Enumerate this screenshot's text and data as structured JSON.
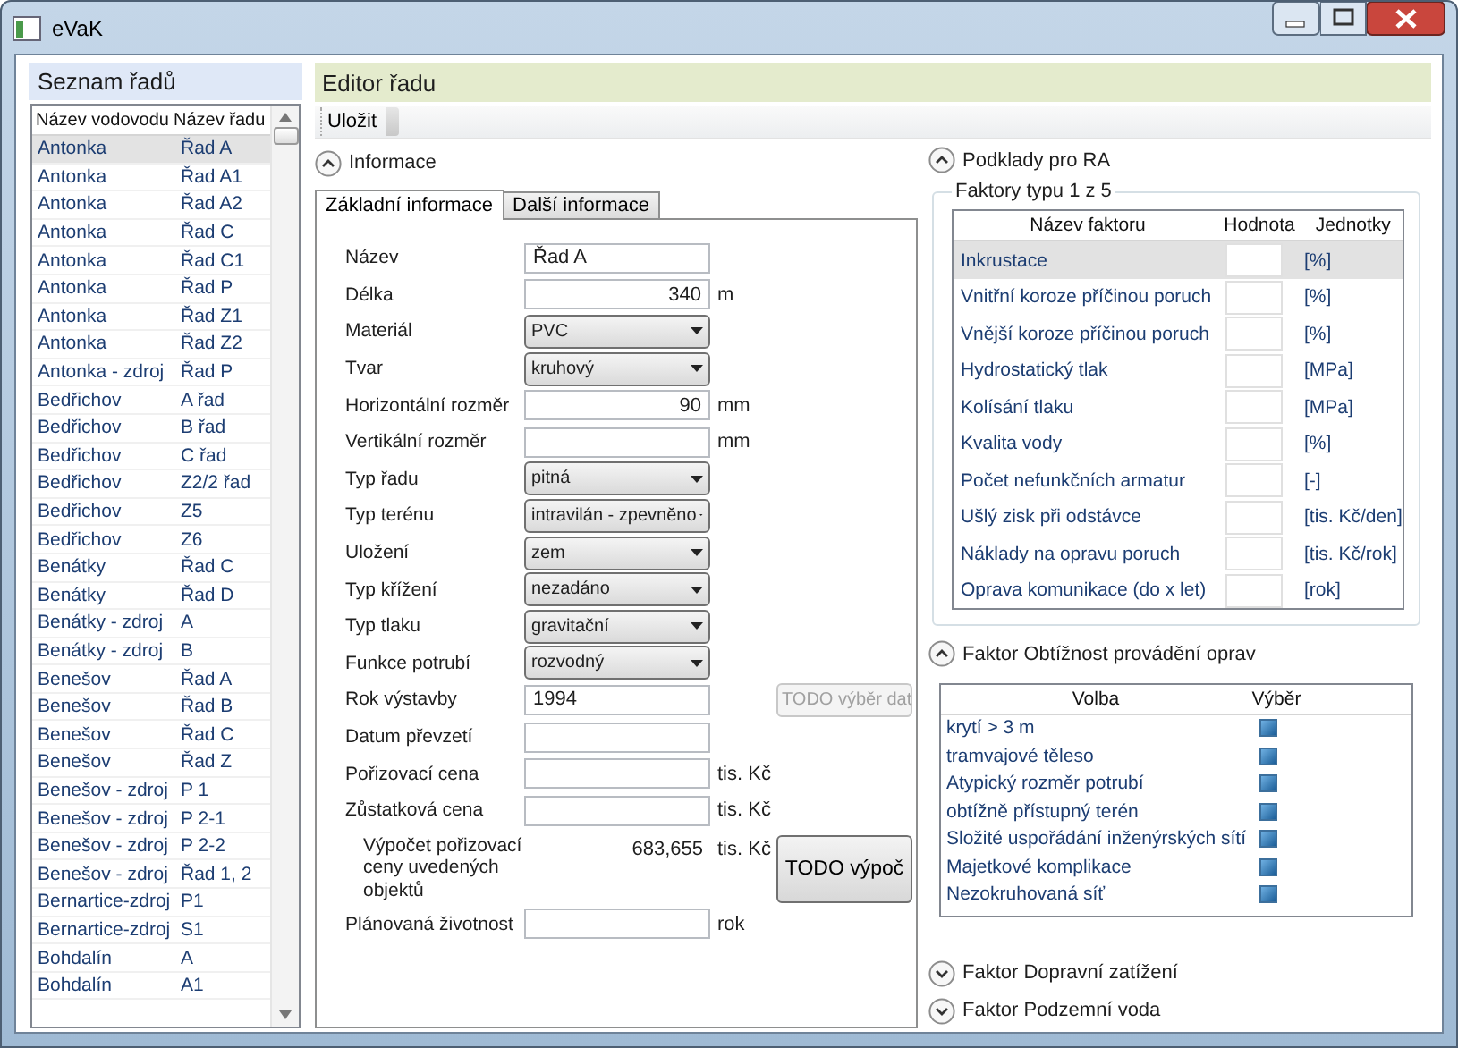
{
  "window": {
    "title": "eVaK"
  },
  "sidebar": {
    "title": "Seznam řadů",
    "columns": [
      "Název vodovodu",
      "Název řadu"
    ],
    "rows": [
      {
        "cells": [
          "Antonka",
          "Řad A"
        ],
        "selected": true
      },
      {
        "cells": [
          "Antonka",
          "Řad A1"
        ],
        "selected": false
      },
      {
        "cells": [
          "Antonka",
          "Řad A2"
        ],
        "selected": false
      },
      {
        "cells": [
          "Antonka",
          "Řad C"
        ],
        "selected": false
      },
      {
        "cells": [
          "Antonka",
          "Řad C1"
        ],
        "selected": false
      },
      {
        "cells": [
          "Antonka",
          "Řad P"
        ],
        "selected": false
      },
      {
        "cells": [
          "Antonka",
          "Řad Z1"
        ],
        "selected": false
      },
      {
        "cells": [
          "Antonka",
          "Řad Z2"
        ],
        "selected": false
      },
      {
        "cells": [
          "Antonka - zdroj",
          "Řad P"
        ],
        "selected": false
      },
      {
        "cells": [
          "Bedřichov",
          "A řad"
        ],
        "selected": false
      },
      {
        "cells": [
          "Bedřichov",
          "B řad"
        ],
        "selected": false
      },
      {
        "cells": [
          "Bedřichov",
          "C řad"
        ],
        "selected": false
      },
      {
        "cells": [
          "Bedřichov",
          "Z2/2 řad"
        ],
        "selected": false
      },
      {
        "cells": [
          "Bedřichov",
          "Z5"
        ],
        "selected": false
      },
      {
        "cells": [
          "Bedřichov",
          "Z6"
        ],
        "selected": false
      },
      {
        "cells": [
          "Benátky",
          "Řad C"
        ],
        "selected": false
      },
      {
        "cells": [
          "Benátky",
          "Řad D"
        ],
        "selected": false
      },
      {
        "cells": [
          "Benátky - zdroj",
          "A"
        ],
        "selected": false
      },
      {
        "cells": [
          "Benátky - zdroj",
          "B"
        ],
        "selected": false
      },
      {
        "cells": [
          "Benešov",
          "Řad A"
        ],
        "selected": false
      },
      {
        "cells": [
          "Benešov",
          "Řad B"
        ],
        "selected": false
      },
      {
        "cells": [
          "Benešov",
          "Řad C"
        ],
        "selected": false
      },
      {
        "cells": [
          "Benešov",
          "Řad Z"
        ],
        "selected": false
      },
      {
        "cells": [
          "Benešov - zdroj",
          "P 1"
        ],
        "selected": false
      },
      {
        "cells": [
          "Benešov - zdroj",
          "P 2-1"
        ],
        "selected": false
      },
      {
        "cells": [
          "Benešov - zdroj",
          "P 2-2"
        ],
        "selected": false
      },
      {
        "cells": [
          "Benešov - zdroj",
          "Řad 1, 2"
        ],
        "selected": false
      },
      {
        "cells": [
          "Bernartice-zdroj",
          "P1"
        ],
        "selected": false
      },
      {
        "cells": [
          "Bernartice-zdroj",
          "S1"
        ],
        "selected": false
      },
      {
        "cells": [
          "Bohdalín",
          "A"
        ],
        "selected": false
      },
      {
        "cells": [
          "Bohdalín",
          "A1"
        ],
        "selected": false
      }
    ]
  },
  "editor": {
    "title": "Editor řadu",
    "toolbar": [
      "Uložit"
    ],
    "info": {
      "title": "Informace",
      "expanded": true,
      "tabs": [
        {
          "label": "Základní informace",
          "selected": true
        },
        {
          "label": "Další informace",
          "selected": false
        }
      ],
      "fields": [
        {
          "label": "Název",
          "kind": "text",
          "value": "Řad A"
        },
        {
          "label": "Délka",
          "kind": "number",
          "value": "340",
          "unit": "m"
        },
        {
          "label": "Materiál",
          "kind": "select",
          "value": "PVC"
        },
        {
          "label": "Tvar",
          "kind": "select",
          "value": "kruhový"
        },
        {
          "label": "Horizontální rozměr",
          "kind": "number",
          "value": "90",
          "unit": "mm"
        },
        {
          "label": "Vertikální rozměr",
          "kind": "number",
          "unit": "mm"
        },
        {
          "label": "Typ řadu",
          "kind": "select",
          "value": "pitná"
        },
        {
          "label": "Typ terénu",
          "kind": "select",
          "value": "intravilán - zpevněno"
        },
        {
          "label": "Uložení",
          "kind": "select",
          "value": "zem"
        },
        {
          "label": "Typ křížení",
          "kind": "select",
          "value": "nezadáno"
        },
        {
          "label": "Typ tlaku",
          "kind": "select",
          "value": "gravitační"
        },
        {
          "label": "Funkce potrubí",
          "kind": "select",
          "value": "rozvodný"
        },
        {
          "label": "Rok výstavby",
          "kind": "text",
          "value": "1994",
          "button": {
            "label": "TODO výběr dat",
            "disabled": true
          }
        },
        {
          "label": "Datum převzetí",
          "kind": "text"
        },
        {
          "label": "Pořizovací cena",
          "kind": "number",
          "unit": "tis. Kč"
        },
        {
          "label": "Zůstatková cena",
          "kind": "number",
          "unit": "tis. Kč"
        },
        {
          "label": "Výpočet pořizovací ceny uvedených objektů",
          "kind": "computed",
          "value": "683,655",
          "unit": "tis. Kč",
          "button": {
            "label": "TODO výpoč",
            "disabled": false
          }
        },
        {
          "label": "Plánovaná životnost",
          "kind": "number",
          "unit": "rok"
        }
      ]
    },
    "podklady": {
      "title": "Podklady pro RA",
      "expanded": true,
      "group": {
        "title": "Faktory typu 1 z 5",
        "columns": [
          "Název faktoru",
          "Hodnota",
          "Jednotky"
        ],
        "rows": [
          {
            "name": "Inkrustace",
            "unit": "[%]",
            "selected": true
          },
          {
            "name": "Vnitřní koroze příčinou poruch",
            "unit": "[%]",
            "selected": false
          },
          {
            "name": "Vnější koroze příčinou poruch",
            "unit": "[%]",
            "selected": false
          },
          {
            "name": "Hydrostatický tlak",
            "unit": "[MPa]",
            "selected": false
          },
          {
            "name": "Kolísání tlaku",
            "unit": "[MPa]",
            "selected": false
          },
          {
            "name": "Kvalita vody",
            "unit": "[%]",
            "selected": false
          },
          {
            "name": "Počet nefunkčních armatur",
            "unit": "[-]",
            "selected": false
          },
          {
            "name": "Ušlý zisk při odstávce",
            "unit": "[tis. Kč/den]",
            "selected": false
          },
          {
            "name": "Náklady na opravu poruch",
            "unit": "[tis. Kč/rok]",
            "selected": false
          },
          {
            "name": "Oprava komunikace (do x let)",
            "unit": "[rok]",
            "selected": false
          }
        ]
      }
    },
    "sections": [
      {
        "title": "Faktor Obtížnost provádění oprav",
        "expanded": true,
        "columns": [
          "Volba",
          "Výběr"
        ],
        "rows": [
          {
            "label": "krytí > 3 m",
            "checked": true
          },
          {
            "label": "tramvajové těleso",
            "checked": true
          },
          {
            "label": "Atypický rozměr potrubí",
            "checked": true
          },
          {
            "label": "obtížně přístupný terén",
            "checked": true
          },
          {
            "label": "Složité uspořádání inženýrských sítí",
            "checked": true
          },
          {
            "label": "Majetkové komplikace",
            "checked": true
          },
          {
            "label": "Nezokruhovaná síť",
            "checked": true
          }
        ]
      },
      {
        "title": "Faktor Dopravní zatížení",
        "expanded": false
      },
      {
        "title": "Faktor Podzemní voda",
        "expanded": false
      }
    ]
  }
}
